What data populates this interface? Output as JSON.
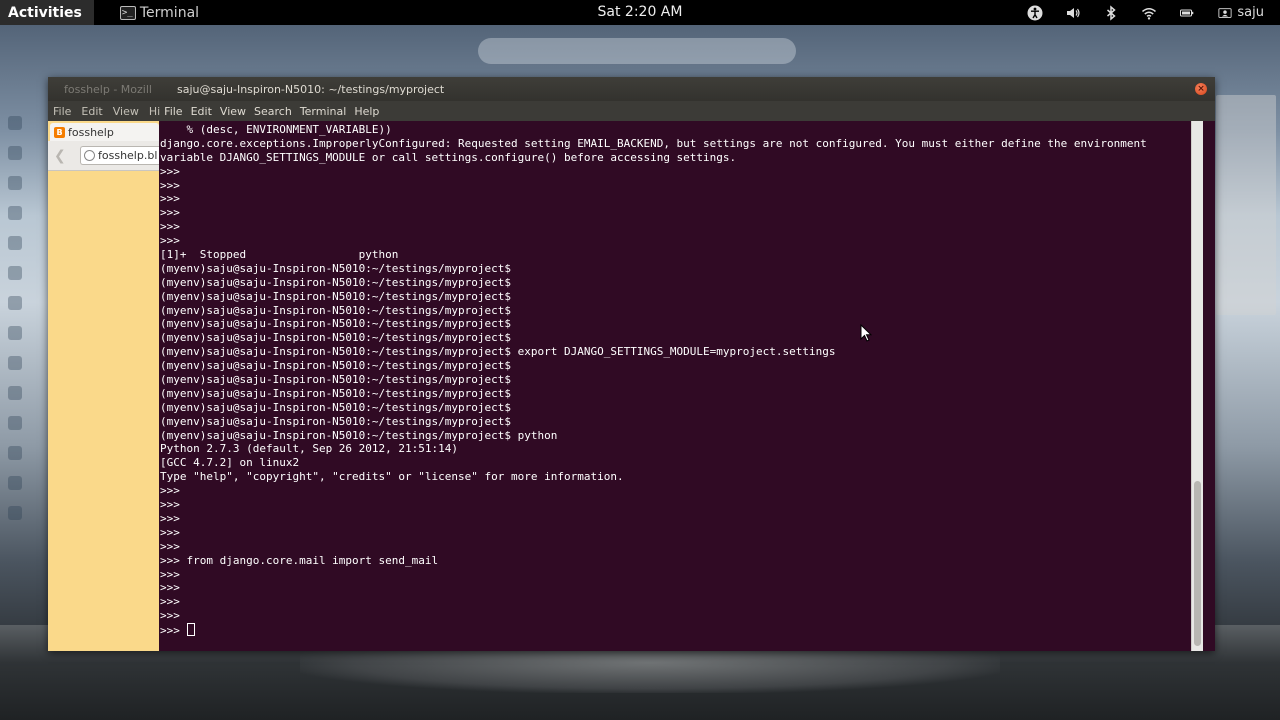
{
  "top_panel": {
    "activities": "Activities",
    "app_name": "Terminal",
    "app_icon": "terminal-icon",
    "clock": "Sat  2:20 AM",
    "user": "saju",
    "tray_icons": [
      "accessibility-icon",
      "volume-icon",
      "bluetooth-icon",
      "wifi-icon",
      "battery-icon",
      "user-icon"
    ]
  },
  "window": {
    "background_title": "fosshelp - Mozill",
    "title": "saju@saju-Inspiron-N5010: ~/testings/myproject",
    "background_menu": [
      "File",
      "Edit",
      "View",
      "Hi"
    ],
    "menu": [
      "File",
      "Edit",
      "View",
      "Search",
      "Terminal",
      "Help"
    ]
  },
  "firefox": {
    "tab_title": "fosshelp",
    "url": "fosshelp.bl"
  },
  "terminal": {
    "lines": [
      "    % (desc, ENVIRONMENT_VARIABLE))",
      "django.core.exceptions.ImproperlyConfigured: Requested setting EMAIL_BACKEND, but settings are not configured. You must either define the environment",
      "variable DJANGO_SETTINGS_MODULE or call settings.configure() before accessing settings.",
      ">>>",
      ">>>",
      ">>>",
      ">>>",
      ">>>",
      ">>>",
      "[1]+  Stopped                 python",
      "(myenv)saju@saju-Inspiron-N5010:~/testings/myproject$",
      "(myenv)saju@saju-Inspiron-N5010:~/testings/myproject$",
      "(myenv)saju@saju-Inspiron-N5010:~/testings/myproject$",
      "(myenv)saju@saju-Inspiron-N5010:~/testings/myproject$",
      "(myenv)saju@saju-Inspiron-N5010:~/testings/myproject$",
      "(myenv)saju@saju-Inspiron-N5010:~/testings/myproject$",
      "(myenv)saju@saju-Inspiron-N5010:~/testings/myproject$ export DJANGO_SETTINGS_MODULE=myproject.settings",
      "(myenv)saju@saju-Inspiron-N5010:~/testings/myproject$",
      "(myenv)saju@saju-Inspiron-N5010:~/testings/myproject$",
      "(myenv)saju@saju-Inspiron-N5010:~/testings/myproject$",
      "(myenv)saju@saju-Inspiron-N5010:~/testings/myproject$",
      "(myenv)saju@saju-Inspiron-N5010:~/testings/myproject$",
      "(myenv)saju@saju-Inspiron-N5010:~/testings/myproject$ python",
      "Python 2.7.3 (default, Sep 26 2012, 21:51:14)",
      "[GCC 4.7.2] on linux2",
      "Type \"help\", \"copyright\", \"credits\" or \"license\" for more information.",
      ">>>",
      ">>>",
      ">>>",
      ">>>",
      ">>>",
      ">>> from django.core.mail import send_mail",
      ">>>",
      ">>>",
      ">>>",
      ">>>"
    ],
    "prompt_line": ">>> "
  },
  "colors": {
    "terminal_bg": "#300a24",
    "terminal_fg": "#ffffff",
    "titlebar_bg": "#3c3b37",
    "close_button": "#e0582a",
    "firefox_bg": "#fad98a"
  }
}
